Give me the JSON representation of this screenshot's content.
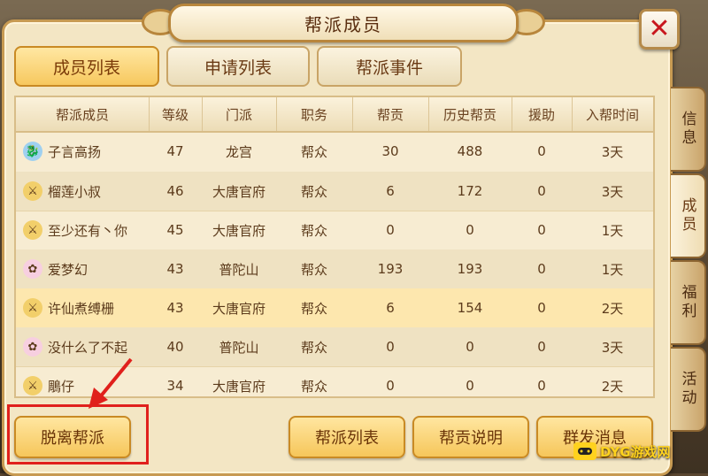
{
  "window": {
    "title": "帮派成员",
    "close_label": "✕"
  },
  "tabs": [
    {
      "label": "成员列表",
      "active": true
    },
    {
      "label": "申请列表",
      "active": false
    },
    {
      "label": "帮派事件",
      "active": false
    }
  ],
  "table": {
    "columns": [
      "帮派成员",
      "等级",
      "门派",
      "职务",
      "帮贡",
      "历史帮贡",
      "援助",
      "入帮时间"
    ],
    "rows": [
      {
        "name": "子言高扬",
        "level": "47",
        "school": "龙宫",
        "role": "帮众",
        "contribution": "30",
        "history": "488",
        "aid": "0",
        "joined": "3天",
        "avatar": "dragon-icon"
      },
      {
        "name": "榴莲小叔",
        "level": "46",
        "school": "大唐官府",
        "role": "帮众",
        "contribution": "6",
        "history": "172",
        "aid": "0",
        "joined": "3天",
        "avatar": "sword-icon"
      },
      {
        "name": "至少还有丶你",
        "level": "45",
        "school": "大唐官府",
        "role": "帮众",
        "contribution": "0",
        "history": "0",
        "aid": "0",
        "joined": "1天",
        "avatar": "sword-icon"
      },
      {
        "name": "爱梦幻",
        "level": "43",
        "school": "普陀山",
        "role": "帮众",
        "contribution": "193",
        "history": "193",
        "aid": "0",
        "joined": "1天",
        "avatar": "lotus-icon"
      },
      {
        "name": "许仙煮缚栅",
        "level": "43",
        "school": "大唐官府",
        "role": "帮众",
        "contribution": "6",
        "history": "154",
        "aid": "0",
        "joined": "2天",
        "avatar": "sword-icon"
      },
      {
        "name": "没什么了不起",
        "level": "40",
        "school": "普陀山",
        "role": "帮众",
        "contribution": "0",
        "history": "0",
        "aid": "0",
        "joined": "3天",
        "avatar": "lotus-icon"
      },
      {
        "name": "鵰仔",
        "level": "34",
        "school": "大唐官府",
        "role": "帮众",
        "contribution": "0",
        "history": "0",
        "aid": "0",
        "joined": "2天",
        "avatar": "sword-icon"
      }
    ]
  },
  "side_tabs": [
    {
      "label": "信息",
      "active": false
    },
    {
      "label": "成员",
      "active": true
    },
    {
      "label": "福利",
      "active": false
    },
    {
      "label": "活动",
      "active": false
    }
  ],
  "buttons": {
    "leave": "脱离帮派",
    "guild_list": "帮派列表",
    "contribution_help": "帮贡说明",
    "broadcast": "群发消息"
  },
  "watermark": {
    "text": "DYG游戏网"
  },
  "colors": {
    "panel_bg": "#f3e6c4",
    "active_button": "#f7c85e",
    "highlight_red": "#e0201c",
    "close_red": "#c8161d"
  }
}
